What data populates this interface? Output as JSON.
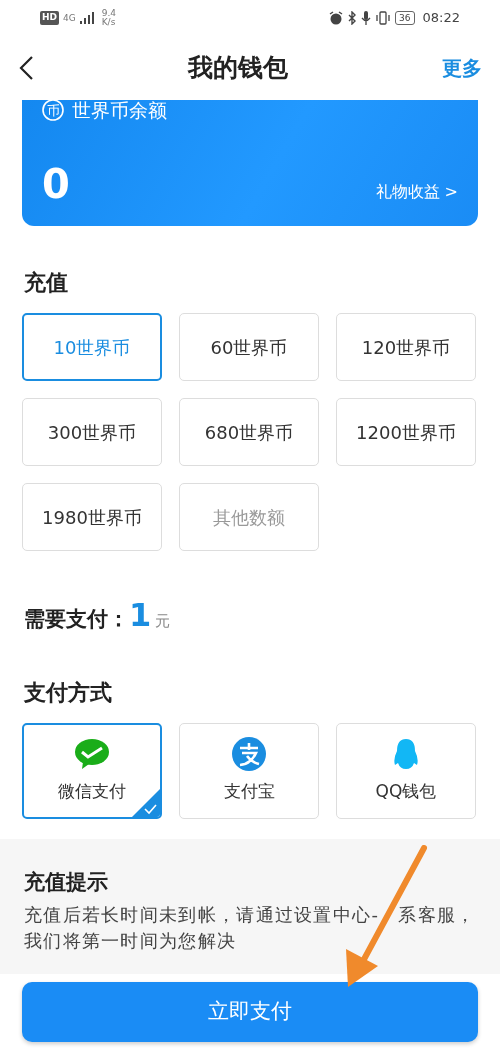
{
  "status_bar": {
    "hd": "HD",
    "network": "4G",
    "speed_value": "9.4",
    "speed_unit": "K/s",
    "battery": "36",
    "time": "08:22"
  },
  "header": {
    "title": "我的钱包",
    "more": "更多"
  },
  "balance": {
    "icon_text": "币",
    "label": "世界币余额",
    "amount": "0",
    "gift_link": "礼物收益 >"
  },
  "recharge": {
    "title": "充值",
    "options": [
      {
        "label": "10世界币",
        "selected": true,
        "kind": "amount"
      },
      {
        "label": "60世界币",
        "selected": false,
        "kind": "amount"
      },
      {
        "label": "120世界币",
        "selected": false,
        "kind": "amount"
      },
      {
        "label": "300世界币",
        "selected": false,
        "kind": "amount"
      },
      {
        "label": "680世界币",
        "selected": false,
        "kind": "amount"
      },
      {
        "label": "1200世界币",
        "selected": false,
        "kind": "amount"
      },
      {
        "label": "1980世界币",
        "selected": false,
        "kind": "amount"
      },
      {
        "label": "其他数额",
        "selected": false,
        "kind": "custom"
      }
    ]
  },
  "payment_due": {
    "label": "需要支付：",
    "amount": "1",
    "unit": "元"
  },
  "payment_method": {
    "title": "支付方式",
    "options": [
      {
        "label": "微信支付",
        "selected": true,
        "kind": "wechat"
      },
      {
        "label": "支付宝",
        "selected": false,
        "kind": "alipay"
      },
      {
        "label": "QQ钱包",
        "selected": false,
        "kind": "qq"
      }
    ]
  },
  "notice": {
    "title": "充值提示",
    "text": "充值后若长时间未到帐，请通过设置中心-　系客服，我们将第一时间为您解决"
  },
  "pay_button": "立即支付"
}
